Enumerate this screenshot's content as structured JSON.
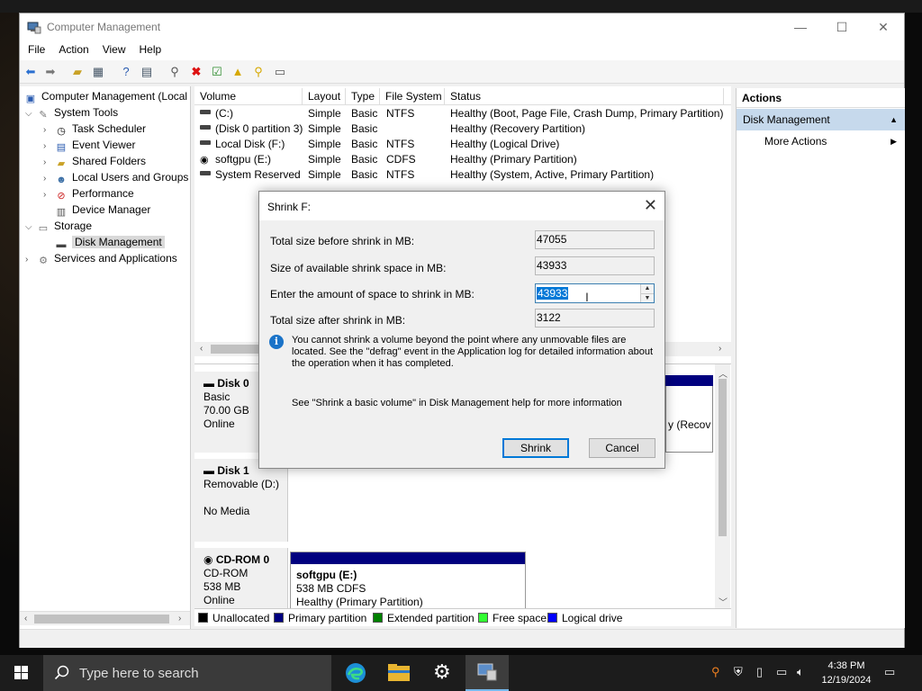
{
  "window": {
    "title": "Computer Management",
    "minimize": "—",
    "maximize": "☐",
    "close": "✕"
  },
  "menu": [
    "File",
    "Action",
    "View",
    "Help"
  ],
  "tree": {
    "root": "Computer Management (Local",
    "system_tools": "System Tools",
    "task_scheduler": "Task Scheduler",
    "event_viewer": "Event Viewer",
    "shared_folders": "Shared Folders",
    "local_users": "Local Users and Groups",
    "performance": "Performance",
    "device_manager": "Device Manager",
    "storage": "Storage",
    "disk_management": "Disk Management",
    "services": "Services and Applications"
  },
  "volume_list": {
    "headers": [
      "Volume",
      "Layout",
      "Type",
      "File System",
      "Status"
    ],
    "rows": [
      {
        "volume": "(C:)",
        "layout": "Simple",
        "type": "Basic",
        "fs": "NTFS",
        "status": "Healthy (Boot, Page File, Crash Dump, Primary Partition)"
      },
      {
        "volume": "(Disk 0 partition 3)",
        "layout": "Simple",
        "type": "Basic",
        "fs": "",
        "status": "Healthy (Recovery Partition)"
      },
      {
        "volume": "Local Disk (F:)",
        "layout": "Simple",
        "type": "Basic",
        "fs": "NTFS",
        "status": "Healthy (Logical Drive)"
      },
      {
        "volume": "softgpu (E:)",
        "layout": "Simple",
        "type": "Basic",
        "fs": "CDFS",
        "status": "Healthy (Primary Partition)"
      },
      {
        "volume": "System Reserved",
        "layout": "Simple",
        "type": "Basic",
        "fs": "NTFS",
        "status": "Healthy (System, Active, Primary Partition)"
      }
    ]
  },
  "disks": {
    "disk0": {
      "name": "Disk 0",
      "type": "Basic",
      "size": "70.00 GB",
      "state": "Online",
      "partial_status": "y (Recov"
    },
    "disk1": {
      "name": "Disk 1",
      "type": "Removable (D:)",
      "state": "No Media"
    },
    "cdrom0": {
      "name": "CD-ROM 0",
      "type": "CD-ROM",
      "size": "538 MB",
      "state": "Online",
      "volume_name": "softgpu  (E:)",
      "volume_size": "538 MB CDFS",
      "volume_status": "Healthy (Primary Partition)"
    }
  },
  "legend": [
    {
      "label": "Unallocated",
      "color": "#000000"
    },
    {
      "label": "Primary partition",
      "color": "#00007f"
    },
    {
      "label": "Extended partition",
      "color": "#008000"
    },
    {
      "label": "Free space",
      "color": "#33ff33"
    },
    {
      "label": "Logical drive",
      "color": "#0000ff"
    }
  ],
  "actions": {
    "header": "Actions",
    "section": "Disk Management",
    "more": "More Actions"
  },
  "dialog": {
    "title": "Shrink F:",
    "total_before_label": "Total size before shrink in MB:",
    "total_before_value": "47055",
    "available_label": "Size of available shrink space in MB:",
    "available_value": "43933",
    "amount_label": "Enter the amount of space to shrink in MB:",
    "amount_value": "43933",
    "total_after_label": "Total size after shrink in MB:",
    "total_after_value": "3122",
    "info": "You cannot shrink a volume beyond the point where any unmovable files are located. See the \"defrag\" event in the Application log for detailed information about the operation when it has completed.",
    "help": "See \"Shrink a basic volume\" in Disk Management help for more information",
    "shrink_button": "Shrink",
    "cancel_button": "Cancel"
  },
  "taskbar": {
    "search_placeholder": "Type here to search",
    "time": "4:38 PM",
    "date": "12/19/2024"
  },
  "colors": {
    "accent": "#0078d7",
    "primary_partition": "#00007f",
    "selection": "#c6d9ec"
  }
}
